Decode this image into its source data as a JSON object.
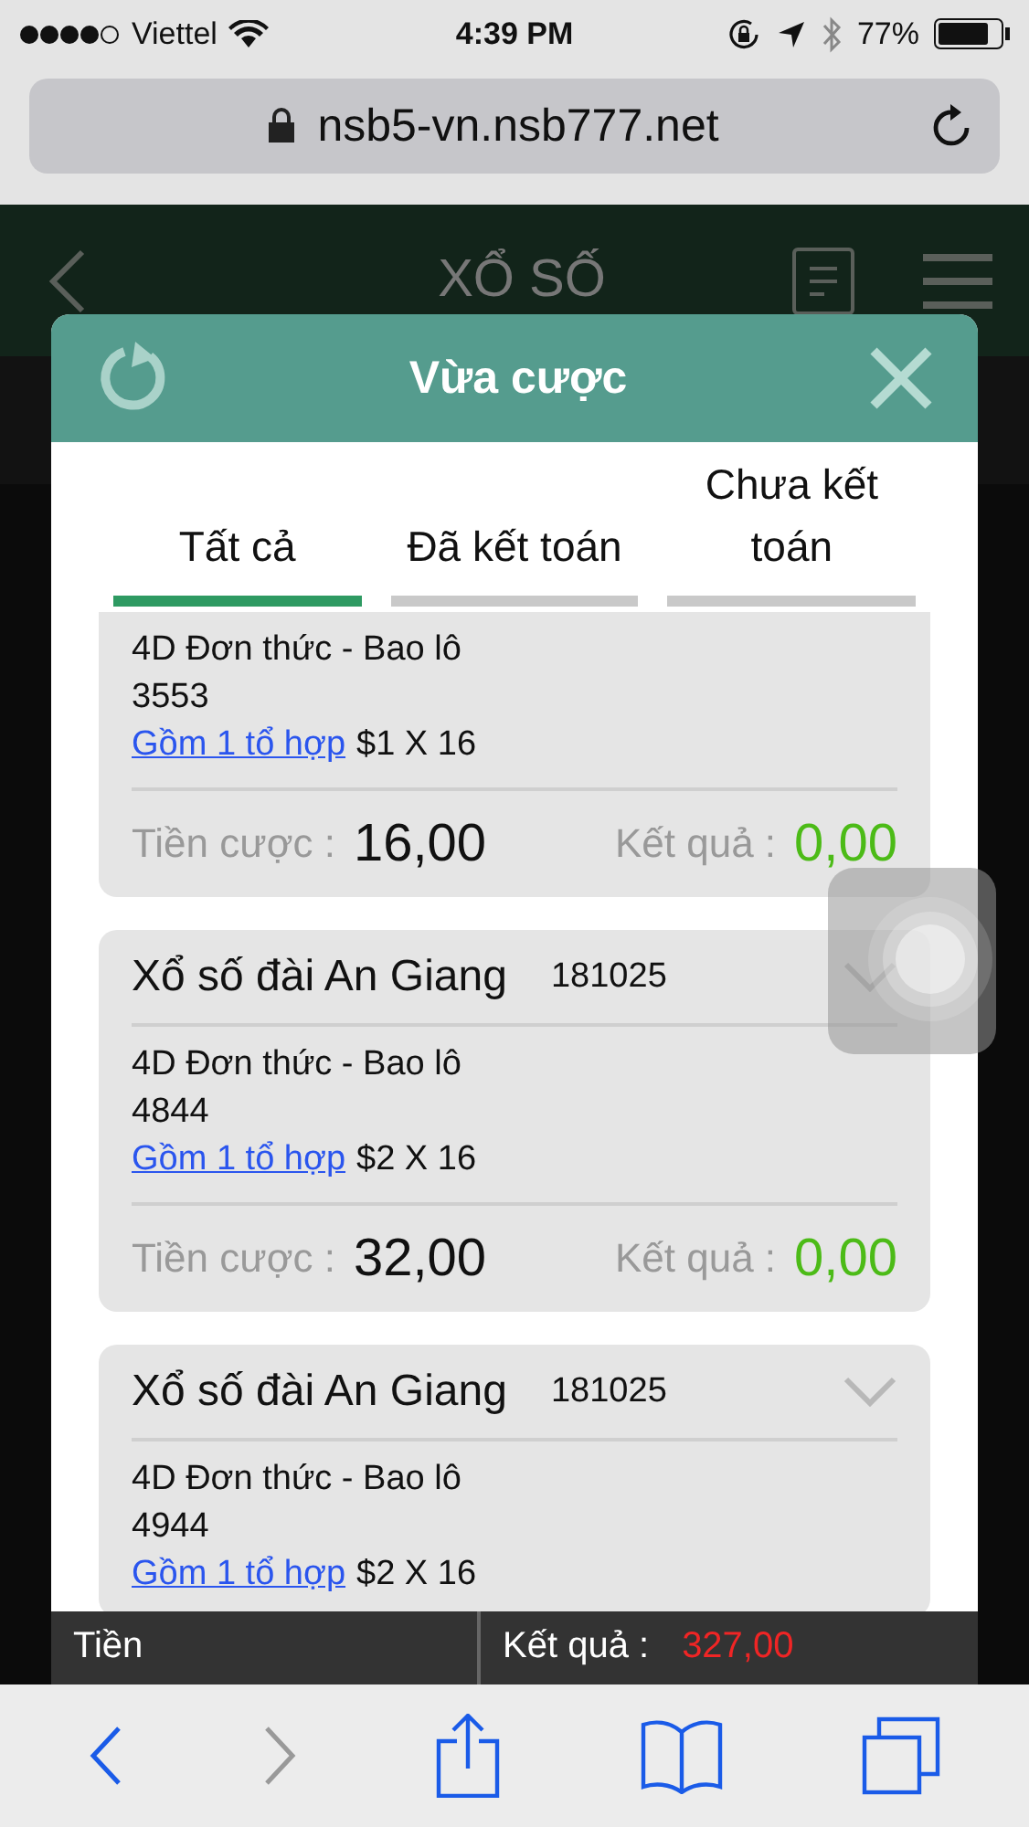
{
  "status_bar": {
    "carrier": "Viettel",
    "time": "4:39 PM",
    "battery": "77%"
  },
  "browser": {
    "url": "nsb5-vn.nsb777.net"
  },
  "header": {
    "title": "XỔ SỐ"
  },
  "modal": {
    "title": "Vừa cược",
    "tabs": [
      {
        "label": "Tất cả",
        "selected": true
      },
      {
        "label": "Đã kết toán",
        "selected": false
      },
      {
        "label": "Chưa kết toán",
        "selected": false
      }
    ]
  },
  "bets": [
    {
      "bet_type": "4D Đơn thức - Bao lô",
      "number": "3553",
      "link": "Gồm 1 tổ hợp",
      "stake_detail": "$1 X 16",
      "stake_label": "Tiền cược :",
      "stake": "16,00",
      "result_label": "Kết quả :",
      "result": "0,00"
    },
    {
      "title": "Xổ số đài An Giang",
      "draw": "181025",
      "bet_type": "4D Đơn thức - Bao lô",
      "number": "4844",
      "link": "Gồm 1 tổ hợp",
      "stake_detail": "$2 X 16",
      "stake_label": "Tiền cược :",
      "stake": "32,00",
      "result_label": "Kết quả :",
      "result": "0,00"
    },
    {
      "title": "Xổ số đài An Giang",
      "draw": "181025",
      "bet_type": "4D Đơn thức - Bao lô",
      "number": "4944",
      "link": "Gồm 1 tổ hợp",
      "stake_detail": "$2 X 16"
    }
  ],
  "summary": {
    "stake_label": "Tiền",
    "result_label": "Kết quả :",
    "result": "327,00"
  }
}
